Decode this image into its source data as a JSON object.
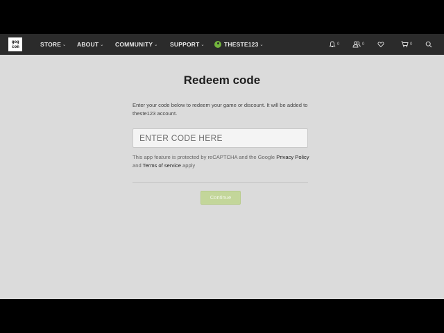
{
  "logo": {
    "text": "gog com"
  },
  "nav": {
    "store": "STORE",
    "about": "ABOUT",
    "community": "COMMUNITY",
    "support": "SUPPORT",
    "user": "THESTE123"
  },
  "icons": {
    "notifications_count": "0",
    "friends_count": "0",
    "cart_count": "0"
  },
  "page": {
    "title": "Redeem code",
    "description": "Enter your code below to redeem your game or discount. It will be added to theste123 account.",
    "input_placeholder": "ENTER CODE HERE",
    "recaptcha_prefix": "This app feature is protected by reCAPTCHA and the Google ",
    "privacy_link": "Privacy Policy",
    "and_text": " and ",
    "terms_link": "Terms of service",
    "apply_text": " apply",
    "continue_label": "Continue"
  },
  "colors": {
    "navbar": "#2b2b2b",
    "background": "#dbdbdb",
    "accent_green": "#73b53d",
    "continue_disabled": "#c3d69a"
  }
}
